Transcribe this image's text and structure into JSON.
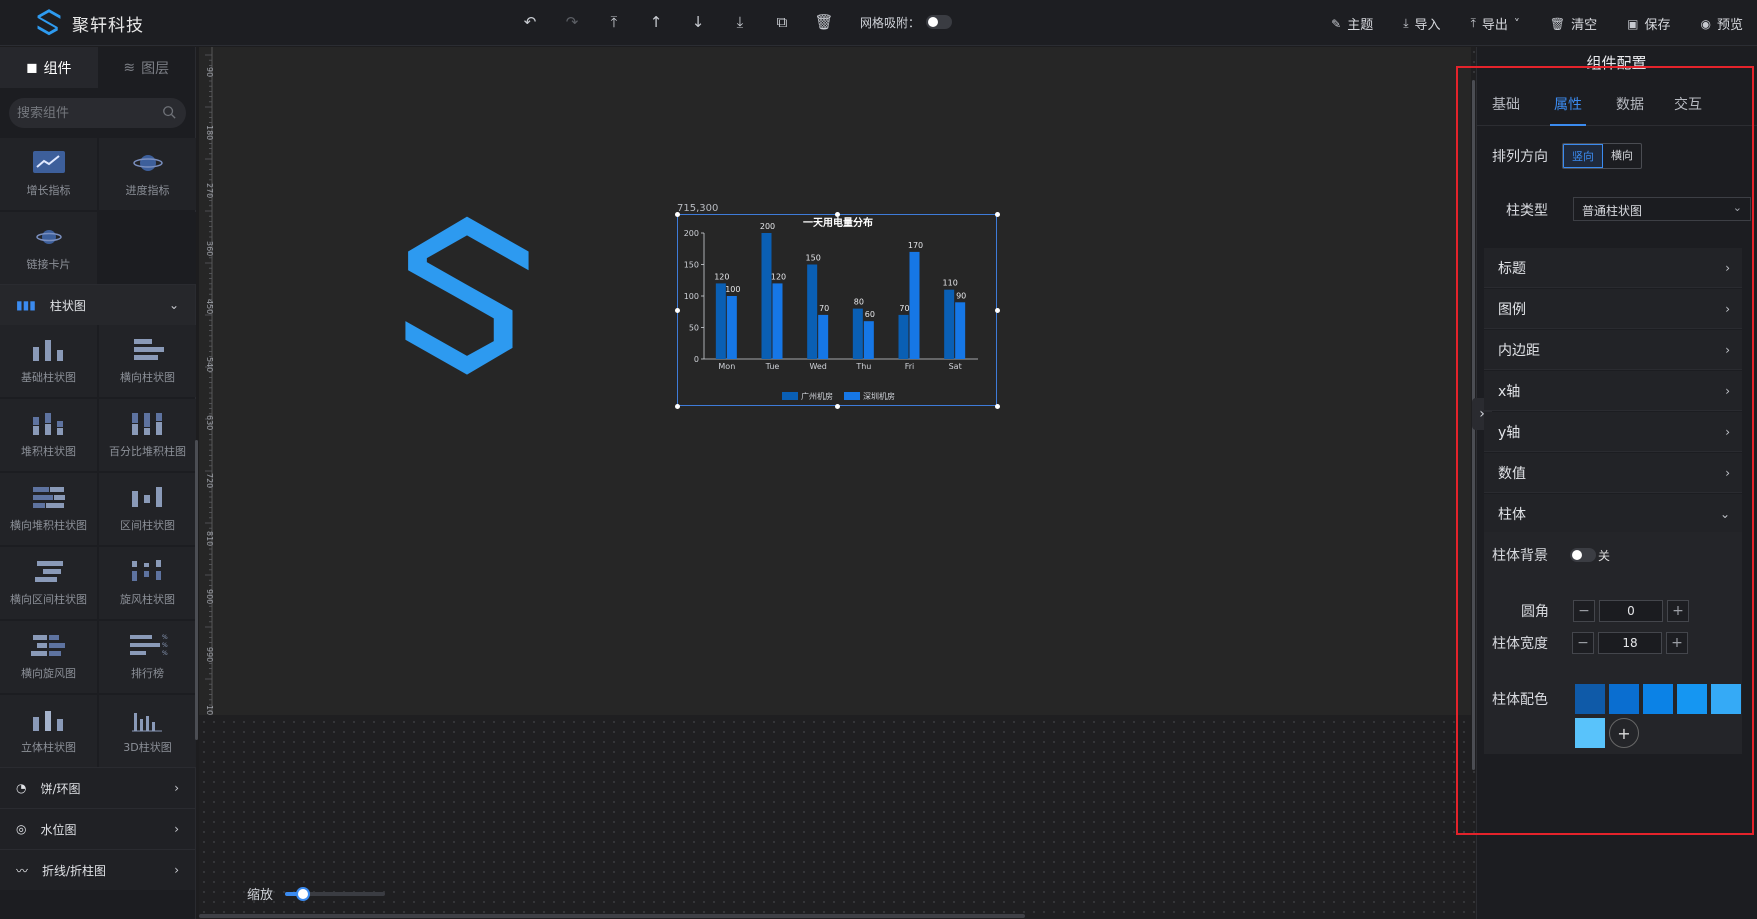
{
  "app": {
    "name": "聚轩科技"
  },
  "toolbar": {
    "grid_snap_label": "网格吸附："
  },
  "actions": [
    {
      "label": "主题",
      "icon": "theme-icon"
    },
    {
      "label": "导入",
      "icon": "import-icon"
    },
    {
      "label": "导出",
      "icon": "export-icon"
    },
    {
      "label": "清空",
      "icon": "clear-icon"
    },
    {
      "label": "保存",
      "icon": "save-icon"
    },
    {
      "label": "预览",
      "icon": "preview-icon"
    }
  ],
  "left": {
    "tabs": [
      "组件",
      "图层"
    ],
    "search_placeholder": "搜索组件",
    "top_cards": [
      "增长指标",
      "进度指标",
      "链接卡片"
    ],
    "open_category": "柱状图",
    "bar_cards": [
      "基础柱状图",
      "横向柱状图",
      "堆积柱状图",
      "百分比堆积柱图",
      "横向堆积柱状图",
      "区间柱状图",
      "横向区间柱状图",
      "旋风柱状图",
      "横向旋风图",
      "排行榜",
      "立体柱状图",
      "3D柱状图"
    ],
    "categories": [
      "饼/环图",
      "水位图",
      "折线/折柱图"
    ]
  },
  "canvas": {
    "ruler_ticks": [
      "90",
      "180",
      "270",
      "360",
      "450",
      "540",
      "630",
      "720",
      "810",
      "900",
      "990",
      "1080"
    ],
    "zoom_label": "缩放",
    "zoom_value": 0.18,
    "chart_coord": "715,300"
  },
  "chart_data": {
    "type": "bar",
    "title": "一天用电量分布",
    "categories": [
      "Mon",
      "Tue",
      "Wed",
      "Thu",
      "Fri",
      "Sat"
    ],
    "series": [
      {
        "name": "广州机房",
        "values": [
          120,
          200,
          150,
          80,
          70,
          110
        ],
        "color": "#0a5fb4"
      },
      {
        "name": "深圳机房",
        "values": [
          100,
          120,
          70,
          60,
          170,
          90
        ],
        "color": "#1677e6"
      }
    ],
    "ylim": [
      0,
      200
    ],
    "yticks": [
      "0",
      "50",
      "100",
      "150",
      "200"
    ],
    "legend": "bottom"
  },
  "right": {
    "title": "组件配置",
    "tabs": [
      "基础",
      "属性",
      "数据",
      "交互"
    ],
    "active_tab": "属性",
    "direction_label": "排列方向",
    "direction_options": [
      "竖向",
      "横向"
    ],
    "bar_type_label": "柱类型",
    "bar_type_value": "普通柱状图",
    "sections": [
      "标题",
      "图例",
      "内边距",
      "x轴",
      "y轴",
      "数值",
      "柱体"
    ],
    "bar_bg_label": "柱体背景",
    "bar_bg_state": "关",
    "radius_label": "圆角",
    "radius_value": "0",
    "width_label": "柱体宽度",
    "width_value": "18",
    "color_label": "柱体配色",
    "colors": [
      "#0f5aa8",
      "#0a6ed0",
      "#0b82e6",
      "#1596f2",
      "#35aaf6",
      "#59c3fb"
    ]
  }
}
